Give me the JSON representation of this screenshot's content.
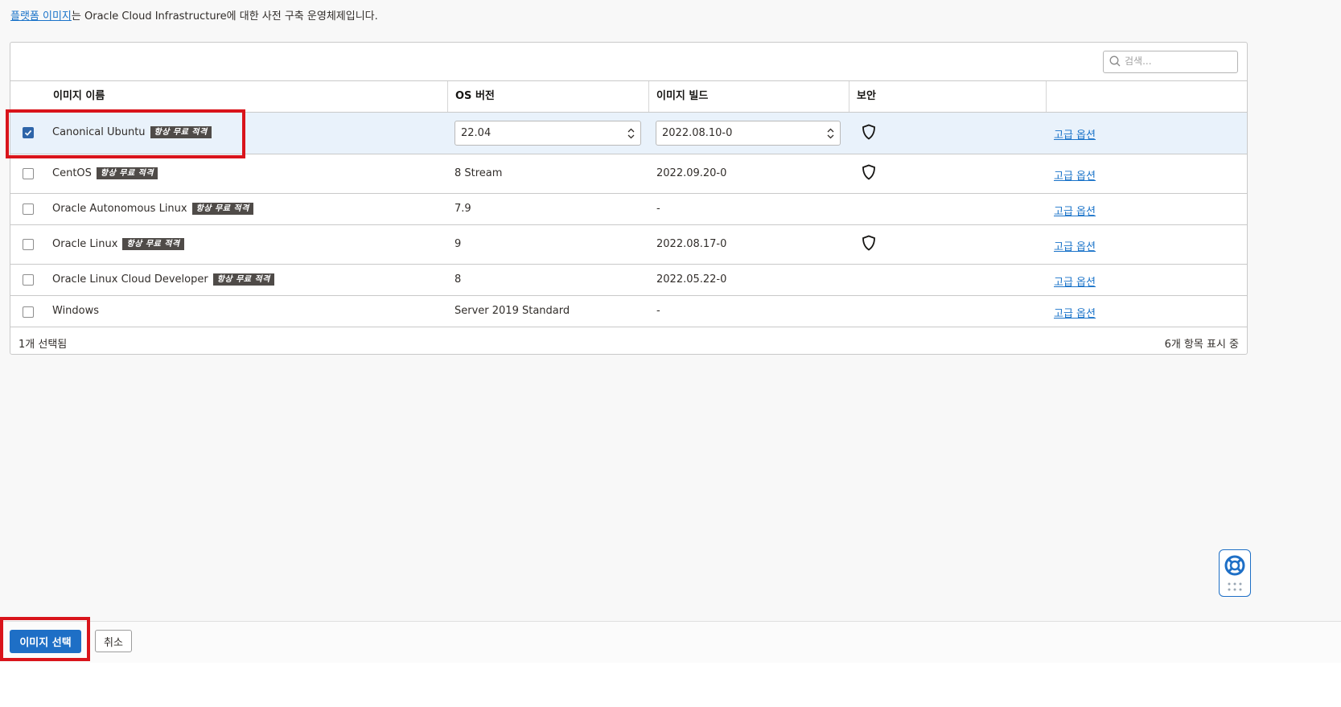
{
  "intro": {
    "link_text": "플랫폼 이미지",
    "rest_text": "는 Oracle Cloud Infrastructure에 대한 사전 구축 운영체제입니다."
  },
  "search": {
    "placeholder": "검색...",
    "icon": "search-icon"
  },
  "table": {
    "headers": {
      "name": "이미지 이름",
      "os_version": "OS 버전",
      "build": "이미지 빌드",
      "security": "보안"
    },
    "rows": [
      {
        "selected": true,
        "name": "Canonical Ubuntu",
        "badge": "항상 무료 적격",
        "os_version": "22.04",
        "build": "2022.08.10-0",
        "security": true,
        "link": "고급 옵션"
      },
      {
        "selected": false,
        "name": "CentOS",
        "badge": "항상 무료 적격",
        "os_version": "8 Stream",
        "build": "2022.09.20-0",
        "security": true,
        "link": "고급 옵션"
      },
      {
        "selected": false,
        "name": "Oracle Autonomous Linux",
        "badge": "항상 무료 적격",
        "os_version": "7.9",
        "build": "-",
        "security": false,
        "link": "고급 옵션"
      },
      {
        "selected": false,
        "name": "Oracle Linux",
        "badge": "항상 무료 적격",
        "os_version": "9",
        "build": "2022.08.17-0",
        "security": true,
        "link": "고급 옵션"
      },
      {
        "selected": false,
        "name": "Oracle Linux Cloud Developer",
        "badge": "항상 무료 적격",
        "os_version": "8",
        "build": "2022.05.22-0",
        "security": false,
        "link": "고급 옵션"
      },
      {
        "selected": false,
        "name": "Windows",
        "badge": "",
        "os_version": "Server 2019 Standard",
        "build": "-",
        "security": false,
        "link": "고급 옵션"
      }
    ],
    "footer": {
      "selected_count": "1개 선택됨",
      "items_shown": "6개 항목 표시 중"
    }
  },
  "actions": {
    "select_image": "이미지 선택",
    "cancel": "취소"
  },
  "colors": {
    "accent": "#1e6fc6",
    "highlight": "#d9141b",
    "badge_bg": "#4f4b48",
    "selected_row": "#e9f2fb"
  }
}
